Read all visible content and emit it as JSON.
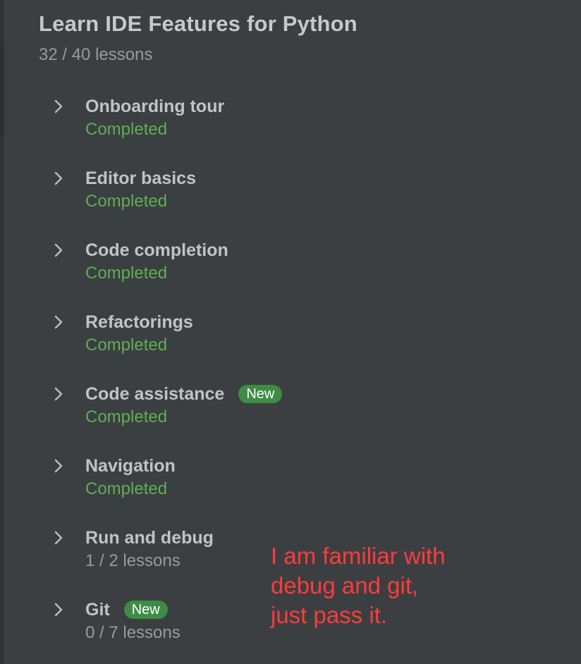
{
  "header": {
    "title": "Learn IDE Features for Python",
    "progress_text": "32 / 40 lessons"
  },
  "lessons": [
    {
      "title": "Onboarding tour",
      "status": "Completed",
      "badge": ""
    },
    {
      "title": "Editor basics",
      "status": "Completed",
      "badge": ""
    },
    {
      "title": "Code completion",
      "status": "Completed",
      "badge": ""
    },
    {
      "title": "Refactorings",
      "status": "Completed",
      "badge": ""
    },
    {
      "title": "Code assistance",
      "status": "Completed",
      "badge": "New"
    },
    {
      "title": "Navigation",
      "status": "Completed",
      "badge": ""
    },
    {
      "title": "Run and debug",
      "status": "1 / 2 lessons",
      "badge": ""
    },
    {
      "title": "Git",
      "status": "0 / 7 lessons",
      "badge": "New"
    }
  ],
  "annotation": {
    "lines": [
      "I am familiar with",
      "debug and git,",
      "just pass it."
    ]
  },
  "colors": {
    "background": "#3c3f41",
    "completed": "#5fad56",
    "badge": "#3e8c46",
    "annotation": "#ff3b3b"
  },
  "icons": {
    "expand": "chevron-right-icon"
  }
}
